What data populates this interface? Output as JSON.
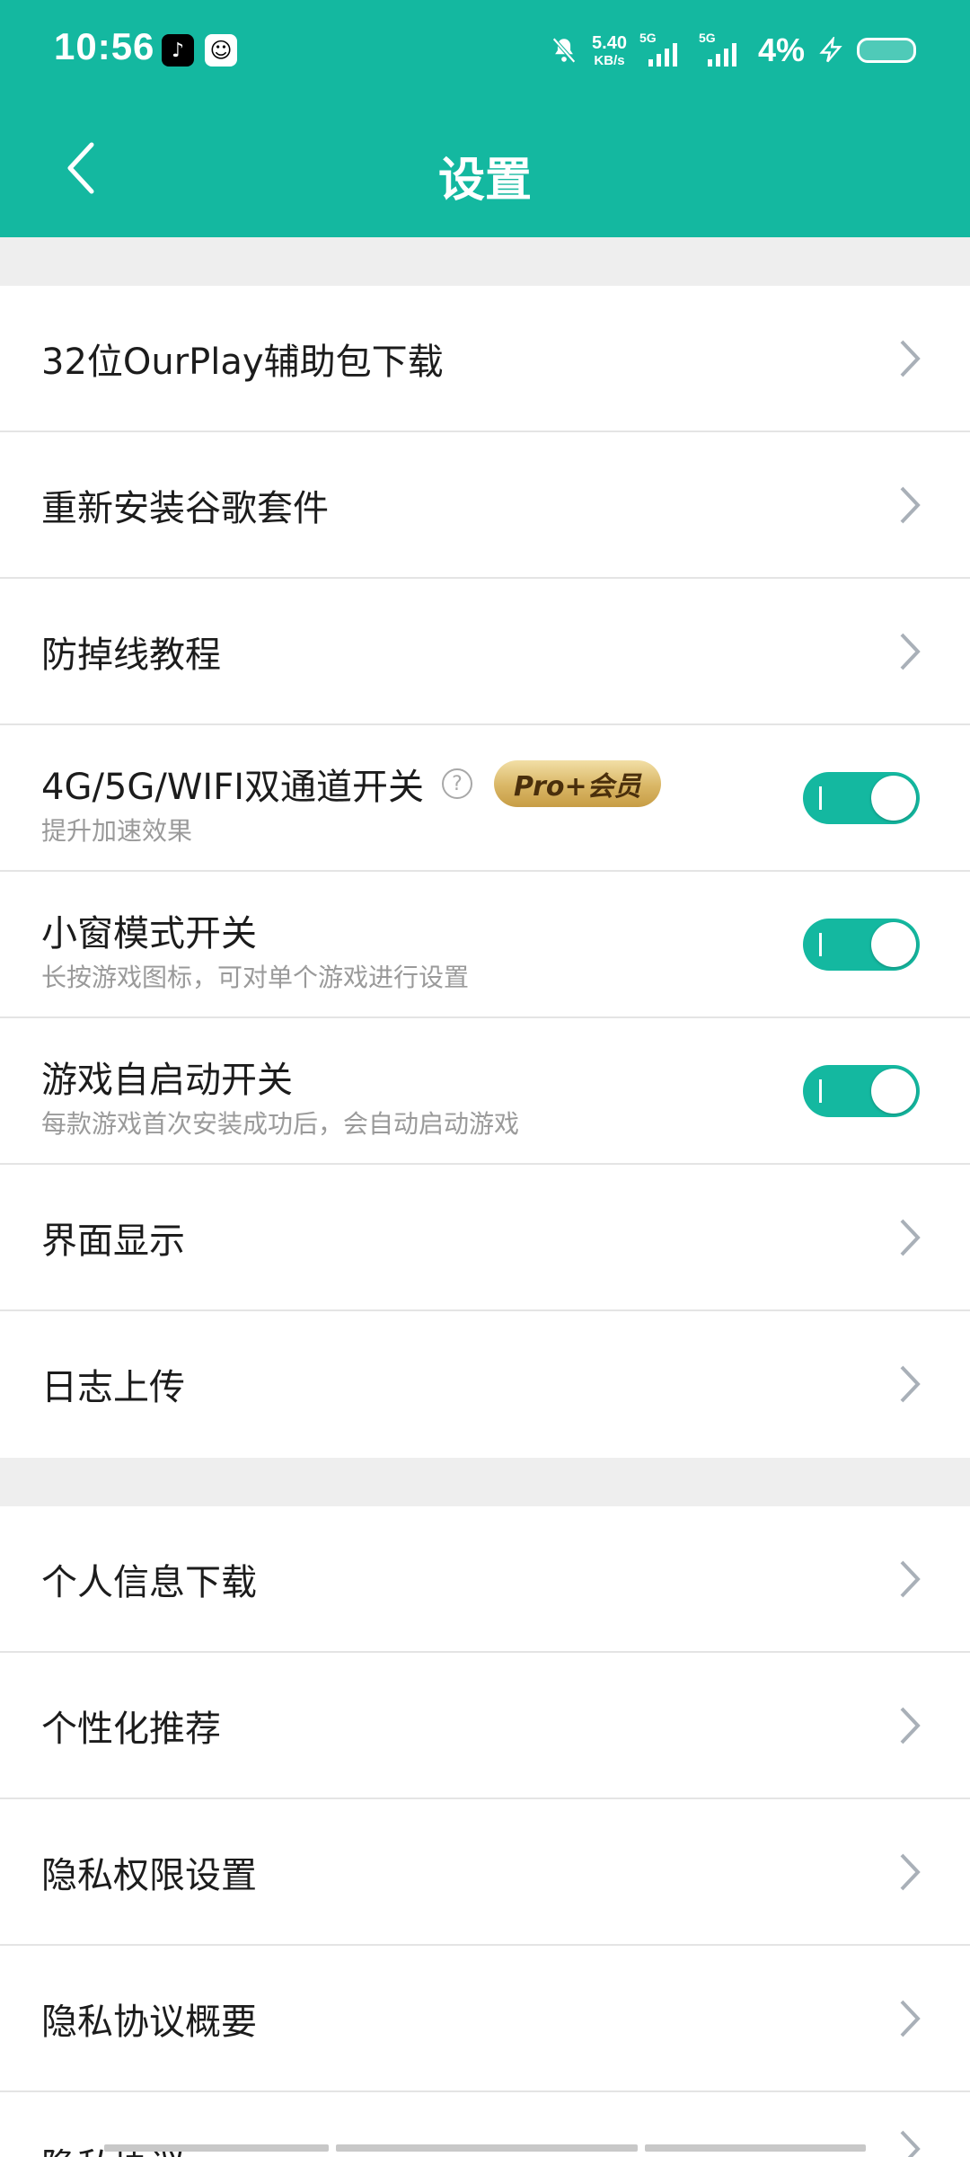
{
  "status_bar": {
    "time": "10:56",
    "net_speed_value": "5.40",
    "net_speed_unit": "KB/s",
    "sim1_label": "5G",
    "sim2_label": "5G",
    "battery": "4%"
  },
  "header": {
    "title": "设置"
  },
  "section1": [
    {
      "label": "32位OurPlay辅助包下载"
    },
    {
      "label": "重新安装谷歌套件"
    },
    {
      "label": "防掉线教程"
    },
    {
      "label": "4G/5G/WIFI双通道开关",
      "sub": "提升加速效果",
      "badge": "Pro+会员",
      "help": "?",
      "toggle": true
    },
    {
      "label": "小窗模式开关",
      "sub": "长按游戏图标，可对单个游戏进行设置",
      "toggle": true
    },
    {
      "label": "游戏自启动开关",
      "sub": "每款游戏首次安装成功后，会自动启动游戏",
      "toggle": true
    },
    {
      "label": "界面显示"
    },
    {
      "label": "日志上传"
    }
  ],
  "section2": [
    {
      "label": "个人信息下载"
    },
    {
      "label": "个性化推荐"
    },
    {
      "label": "隐私权限设置"
    },
    {
      "label": "隐私协议概要"
    }
  ],
  "partial_row": {
    "label": "隐私协议"
  },
  "colors": {
    "accent": "#14b8a0",
    "badge_gold": "#d9b665",
    "divider": "#e4e4e4"
  }
}
